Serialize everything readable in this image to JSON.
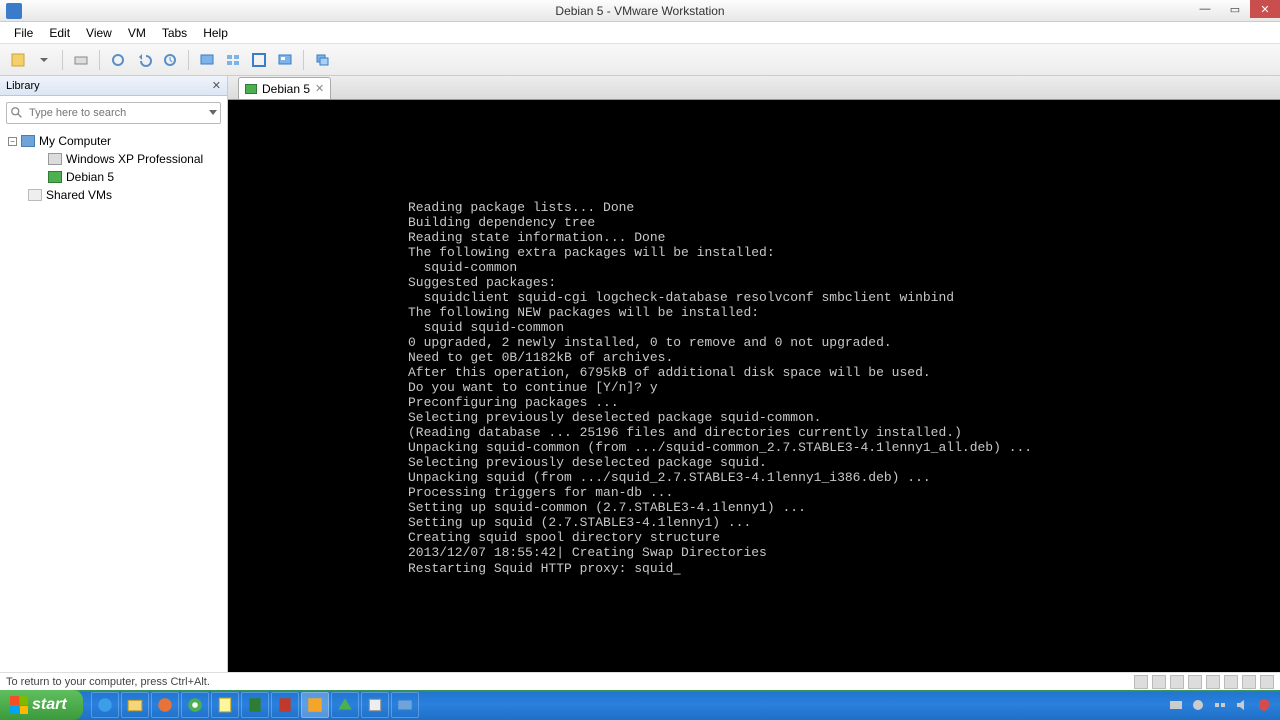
{
  "window": {
    "title": "Debian 5 - VMware Workstation"
  },
  "menu": {
    "file": "File",
    "edit": "Edit",
    "view": "View",
    "vm": "VM",
    "tabs": "Tabs",
    "help": "Help"
  },
  "library": {
    "title": "Library",
    "search_placeholder": "Type here to search",
    "my_computer": "My Computer",
    "winxp": "Windows XP Professional",
    "debian": "Debian 5",
    "shared": "Shared VMs"
  },
  "tab": {
    "label": "Debian 5"
  },
  "terminal": {
    "lines": [
      "Reading package lists... Done",
      "Building dependency tree",
      "Reading state information... Done",
      "The following extra packages will be installed:",
      "  squid-common",
      "Suggested packages:",
      "  squidclient squid-cgi logcheck-database resolvconf smbclient winbind",
      "The following NEW packages will be installed:",
      "  squid squid-common",
      "0 upgraded, 2 newly installed, 0 to remove and 0 not upgraded.",
      "Need to get 0B/1182kB of archives.",
      "After this operation, 6795kB of additional disk space will be used.",
      "Do you want to continue [Y/n]? y",
      "Preconfiguring packages ...",
      "Selecting previously deselected package squid-common.",
      "(Reading database ... 25196 files and directories currently installed.)",
      "Unpacking squid-common (from .../squid-common_2.7.STABLE3-4.1lenny1_all.deb) ...",
      "Selecting previously deselected package squid.",
      "Unpacking squid (from .../squid_2.7.STABLE3-4.1lenny1_i386.deb) ...",
      "Processing triggers for man-db ...",
      "Setting up squid-common (2.7.STABLE3-4.1lenny1) ...",
      "Setting up squid (2.7.STABLE3-4.1lenny1) ...",
      "Creating squid spool directory structure",
      "2013/12/07 18:55:42| Creating Swap Directories",
      "Restarting Squid HTTP proxy: squid"
    ]
  },
  "status": {
    "hint": "To return to your computer, press Ctrl+Alt."
  },
  "taskbar": {
    "start": "start"
  }
}
